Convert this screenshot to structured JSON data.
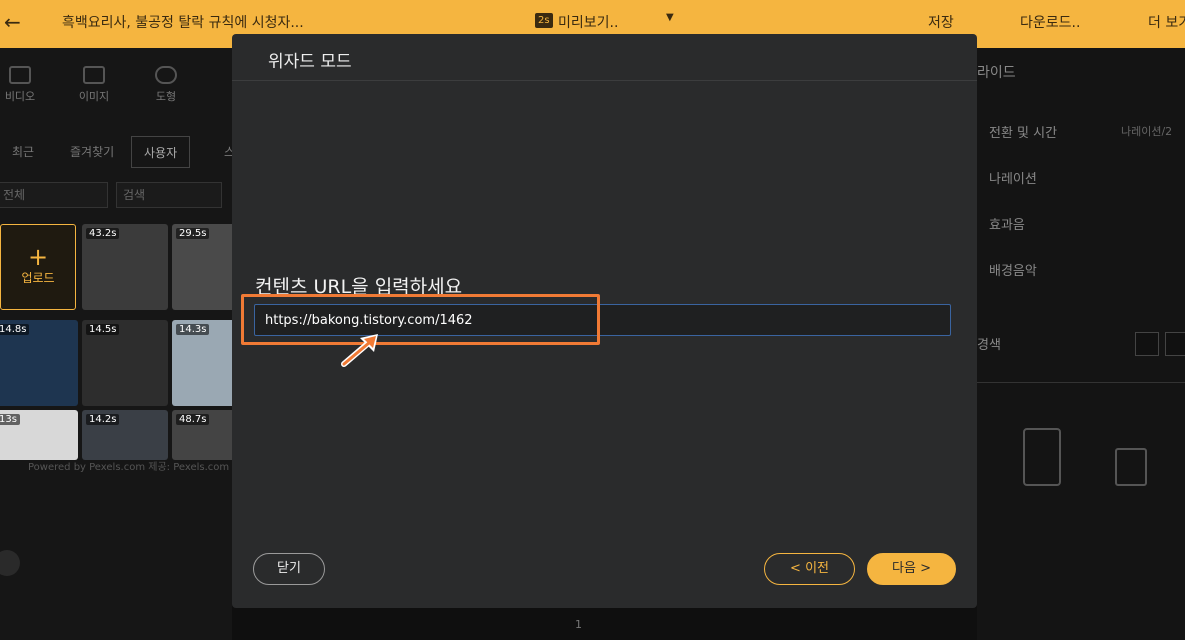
{
  "topbar": {
    "back_icon": "arrow-left-icon",
    "title": "흑백요리사, 불공정 탈락 규칙에 시청자...",
    "duration_badge": "2s",
    "preview_label": "미리보기..",
    "save_label": "저장",
    "download_label": "다운로드..",
    "more_label": "더 보기"
  },
  "left_panel": {
    "categories": [
      "비디오",
      "이미지",
      "도형"
    ],
    "subtabs": [
      "최근",
      "즐겨찾기",
      "사용자",
      "스"
    ],
    "filter_all": "전체",
    "search_placeholder": "검색",
    "upload_label": "업로드",
    "tile_durations": [
      "43.2s",
      "29.5s",
      "14.8s",
      "14.5s",
      "14.3s",
      "13s",
      "14.2s",
      "48.7s"
    ],
    "powered_by": "Powered by Pexels.com 제공: Pexels.com"
  },
  "right_panel": {
    "title": "라이드",
    "items": [
      "전환 및 시간",
      "나레이션",
      "효과음",
      "배경음악",
      "경색"
    ],
    "sub_label": "나레이션/2"
  },
  "page_number": "1",
  "modal": {
    "title": "위자드 모드",
    "url_prompt": "컨텐츠 URL을 입력하세요",
    "url_value": "https://bakong.tistory.com/1462",
    "close_label": "닫기",
    "prev_label": "이전",
    "next_label": "다음",
    "highlight_color": "#f07a35",
    "accent_color": "#f5b540"
  }
}
